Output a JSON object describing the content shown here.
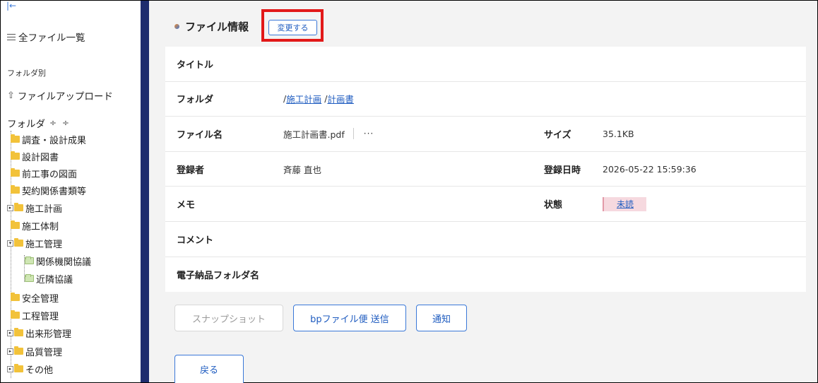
{
  "sidebar": {
    "collapse_icon": "collapse-left-icon",
    "all_files": "全ファイル一覧",
    "section_label": "フォルダ別",
    "upload": "ファイルアップロード",
    "folder_header": "フォルダ",
    "sort_glyphs": "÷ ÷",
    "tree": [
      {
        "label": "調査・設計成果",
        "level": 0,
        "expander": false
      },
      {
        "label": "設計図書",
        "level": 0,
        "expander": false
      },
      {
        "label": "前工事の図面",
        "level": 0,
        "expander": false
      },
      {
        "label": "契約関係書類等",
        "level": 0,
        "expander": false
      },
      {
        "label": "施工計画",
        "level": 0,
        "expander": true,
        "expander_state": "collapsed"
      },
      {
        "label": "施工体制",
        "level": 0,
        "expander": false
      },
      {
        "label": "施工管理",
        "level": 0,
        "expander": true,
        "expander_state": "expanded"
      },
      {
        "label": "関係機関協議",
        "level": 1,
        "expander": false
      },
      {
        "label": "近隣協議",
        "level": 1,
        "expander": false
      },
      {
        "label": "安全管理",
        "level": 0,
        "expander": false
      },
      {
        "label": "工程管理",
        "level": 0,
        "expander": false
      },
      {
        "label": "出来形管理",
        "level": 0,
        "expander": true,
        "expander_state": "collapsed"
      },
      {
        "label": "品質管理",
        "level": 0,
        "expander": true,
        "expander_state": "collapsed"
      },
      {
        "label": "その他",
        "level": 0,
        "expander": true,
        "expander_state": "collapsed"
      }
    ]
  },
  "main": {
    "title": "ファイル情報",
    "edit_button": "変更する",
    "rows": {
      "title_label": "タイトル",
      "title_value": "",
      "folder_label": "フォルダ",
      "folder_path": [
        "施工計画",
        "計画書"
      ],
      "filename_label": "ファイル名",
      "filename_value": "施工計画書.pdf",
      "more_label": "···",
      "size_label": "サイズ",
      "size_value": "35.1KB",
      "registrant_label": "登録者",
      "registrant_value": "斉藤 直也",
      "registered_at_label": "登録日時",
      "registered_at_value": "2026-05-22 15:59:36",
      "memo_label": "メモ",
      "status_label": "状態",
      "status_value": "未読",
      "comment_label": "コメント",
      "delivery_folder_label": "電子納品フォルダ名"
    },
    "buttons": {
      "snapshot": "スナップショット",
      "bp_send": "bpファイル便 送信",
      "notify": "通知",
      "back": "戻る"
    }
  },
  "colors": {
    "sidebar_divider": "#1f2d6e",
    "accent": "#1f5cc0",
    "highlight": "#e21919",
    "status_bg": "#f6d9df"
  }
}
